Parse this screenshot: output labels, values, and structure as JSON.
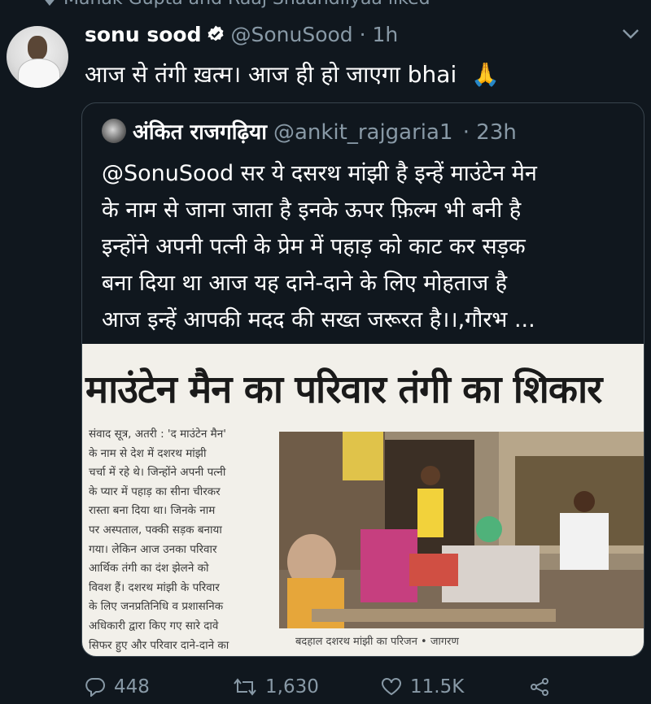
{
  "social_context": {
    "text": "Manak Gupta and Raaj Shaandilyaa liked"
  },
  "tweet": {
    "name": "sonu sood",
    "handle": "@SonuSood",
    "time": "· 1h",
    "text": "आज से तंगी ख़त्म। आज ही हो जाएगा bhai",
    "emoji": "🙏"
  },
  "quoted": {
    "name": "अंकित राजगढ़िया",
    "handle": "@ankit_rajgaria1",
    "time": "· 23h",
    "lines": [
      "@SonuSood  सर ये दसरथ मांझी है इन्हें माउंटेन मेन",
      "के नाम से जाना जाता है इनके ऊपर फ़िल्म भी बनी है",
      "इन्होंने अपनी पत्नी के प्रेम में पहाड़ को काट कर सड़क",
      "बना दिया था आज यह दाने-दाने के लिए मोहताज है",
      "आज इन्हें आपकी मदद की सख्त जरूरत है।।,गौरभ ..."
    ],
    "clipping": {
      "headline": "माउंटेन मैन का परिवार तंगी का शिकार",
      "column": [
        "संवाद सूत्र, अतरी : 'द माउंटेन मैन'",
        "के नाम से देश में दशरथ मांझी",
        "चर्चा में रहे थे। जिन्होंने अपनी पत्नी",
        "के प्यार में पहाड़ का सीना चीरकर",
        "रास्ता बना दिया था। जिनके नाम",
        "पर अस्पताल, पक्की सड़क बनाया",
        "गया। लेकिन आज उनका परिवार",
        "आर्थिक तंगी का दंश झेलने को",
        "विवश हैं। दशरथ मांझी के परिवार",
        "के लिए जनप्रतिनिधि व प्रशासनिक",
        "अधिकारी द्वारा किए गए सारे दावे",
        "सिफर हुए और परिवार दाने-दाने का"
      ],
      "caption": "बदहाल दशरथ मांझी का परिजन • जागरण"
    }
  },
  "actions": {
    "replies": "448",
    "retweets": "1,630",
    "likes": "11.5K"
  },
  "colors": {
    "background": "#10171e",
    "muted": "#8899a6",
    "border": "#38444d",
    "verified": "#ffffff"
  },
  "icons": [
    "heart-icon",
    "verified-icon",
    "chevron-down-icon",
    "reply-icon",
    "retweet-icon",
    "like-icon",
    "share-icon"
  ]
}
